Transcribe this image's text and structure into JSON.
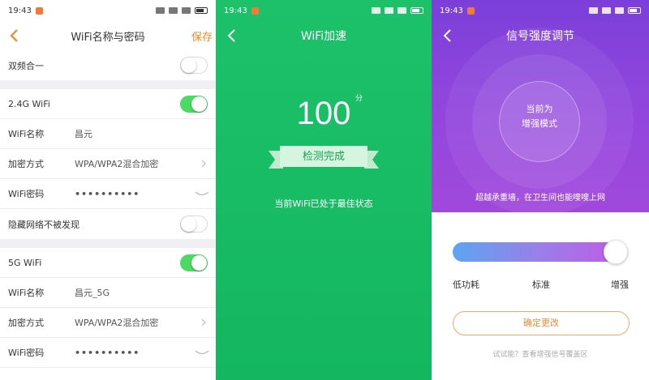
{
  "status_time": "19:43",
  "screen1": {
    "title": "WiFi名称与密码",
    "save_label": "保存",
    "dual_band": {
      "label": "双频合一",
      "on": false
    },
    "band_24g": {
      "label": "2.4G WiFi",
      "on": true,
      "name_label": "WiFi名称",
      "name_value": "昌元",
      "enc_label": "加密方式",
      "enc_value": "WPA/WPA2混合加密",
      "pwd_label": "WiFi密码",
      "pwd_value": "••••••••••"
    },
    "hidden_network": {
      "label": "隐藏网络不被发现",
      "on": false
    },
    "band_5g": {
      "label": "5G WiFi",
      "on": true,
      "name_label": "WiFi名称",
      "name_value": "昌元_5G",
      "enc_label": "加密方式",
      "enc_value": "WPA/WPA2混合加密",
      "pwd_label": "WiFi密码",
      "pwd_value": "••••••••••"
    }
  },
  "screen2": {
    "title": "WiFi加速",
    "score": "100",
    "score_unit": "分",
    "ribbon_label": "检测完成",
    "status_text": "当前WiFi已处于最佳状态"
  },
  "screen3": {
    "title": "信号强度调节",
    "mode_line1": "当前为",
    "mode_line2": "增强模式",
    "hero_caption": "超越承重墙，在卫生间也能嗖嗖上网",
    "slider_level": 1.0,
    "labels": {
      "low": "低功耗",
      "standard": "标准",
      "enhanced": "增强"
    },
    "confirm_label": "确定更改",
    "footer_link": "试试能？查看增强信号覆盖区"
  },
  "colors": {
    "accent_orange": "#f0882a",
    "toggle_on": "#4cd964",
    "green_bg": "#1cc16a",
    "purple_bg": "#8f46dd"
  }
}
